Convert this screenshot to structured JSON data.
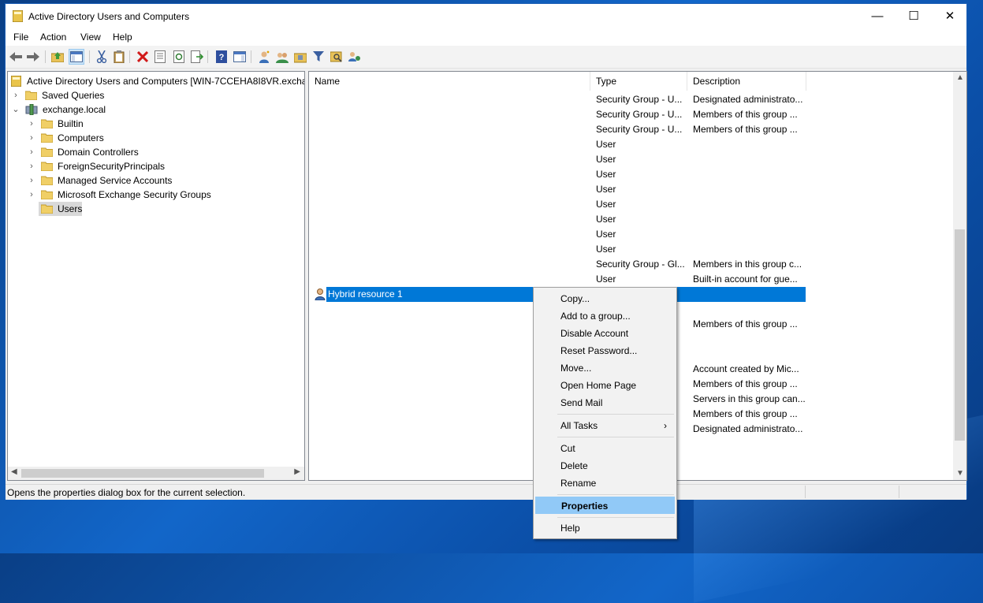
{
  "window": {
    "title": "Active Directory Users and Computers"
  },
  "controls": {
    "minimize": "—",
    "maximize": "☐",
    "close": "✕"
  },
  "menu": [
    "File",
    "Action",
    "View",
    "Help"
  ],
  "tree": {
    "root": "Active Directory Users and Computers [WIN-7CCEHA8I8VR.exchang",
    "saved_queries": "Saved Queries",
    "domain": "exchange.local",
    "children": [
      "Builtin",
      "Computers",
      "Domain Controllers",
      "ForeignSecurityPrincipals",
      "Managed Service Accounts",
      "Microsoft Exchange Security Groups",
      "Users"
    ]
  },
  "list": {
    "headers": {
      "name": "Name",
      "type": "Type",
      "description": "Description"
    },
    "rows": [
      {
        "name": "",
        "type": "Security Group - U...",
        "description": "Designated administrato..."
      },
      {
        "name": "",
        "type": "Security Group - U...",
        "description": "Members of this group ..."
      },
      {
        "name": "",
        "type": "Security Group - U...",
        "description": "Members of this group ..."
      },
      {
        "name": "",
        "type": "User",
        "description": ""
      },
      {
        "name": "",
        "type": "User",
        "description": ""
      },
      {
        "name": "",
        "type": "User",
        "description": ""
      },
      {
        "name": "",
        "type": "User",
        "description": ""
      },
      {
        "name": "",
        "type": "User",
        "description": ""
      },
      {
        "name": "",
        "type": "User",
        "description": ""
      },
      {
        "name": "",
        "type": "User",
        "description": ""
      },
      {
        "name": "",
        "type": "User",
        "description": ""
      },
      {
        "name": "",
        "type": "Security Group - Gl...",
        "description": "Members in this group c..."
      },
      {
        "name": "",
        "type": "User",
        "description": "Built-in account for gue..."
      },
      {
        "name": "Hybrid resource 1",
        "type": "",
        "description": ""
      },
      {
        "name": "",
        "type": "",
        "description": ""
      },
      {
        "name": "",
        "type": "",
        "description": "Members of this group ..."
      },
      {
        "name": "",
        "type": "",
        "description": ""
      },
      {
        "name": "",
        "type": "",
        "description": ""
      },
      {
        "name": "",
        "type": "",
        "description": "Account created by Mic..."
      },
      {
        "name": "",
        "type": "",
        "description": "Members of this group ..."
      },
      {
        "name": "",
        "type": "",
        "description": "Servers in this group can..."
      },
      {
        "name": "",
        "type": "",
        "description": "Members of this group ..."
      },
      {
        "name": "",
        "type": "",
        "description": "Designated administrato..."
      }
    ]
  },
  "context_menu": {
    "copy": "Copy...",
    "add_to_group": "Add to a group...",
    "disable_account": "Disable Account",
    "reset_password": "Reset Password...",
    "move": "Move...",
    "open_home_page": "Open Home Page",
    "send_mail": "Send Mail",
    "all_tasks": "All Tasks",
    "all_tasks_arrow": "›",
    "cut": "Cut",
    "delete": "Delete",
    "rename": "Rename",
    "properties": "Properties",
    "help": "Help"
  },
  "status": {
    "text": "Opens the properties dialog box for the current selection."
  },
  "colors": {
    "selection": "#0078d7",
    "menu_highlight": "#91c9f7",
    "accent": "#1d5fb5"
  }
}
